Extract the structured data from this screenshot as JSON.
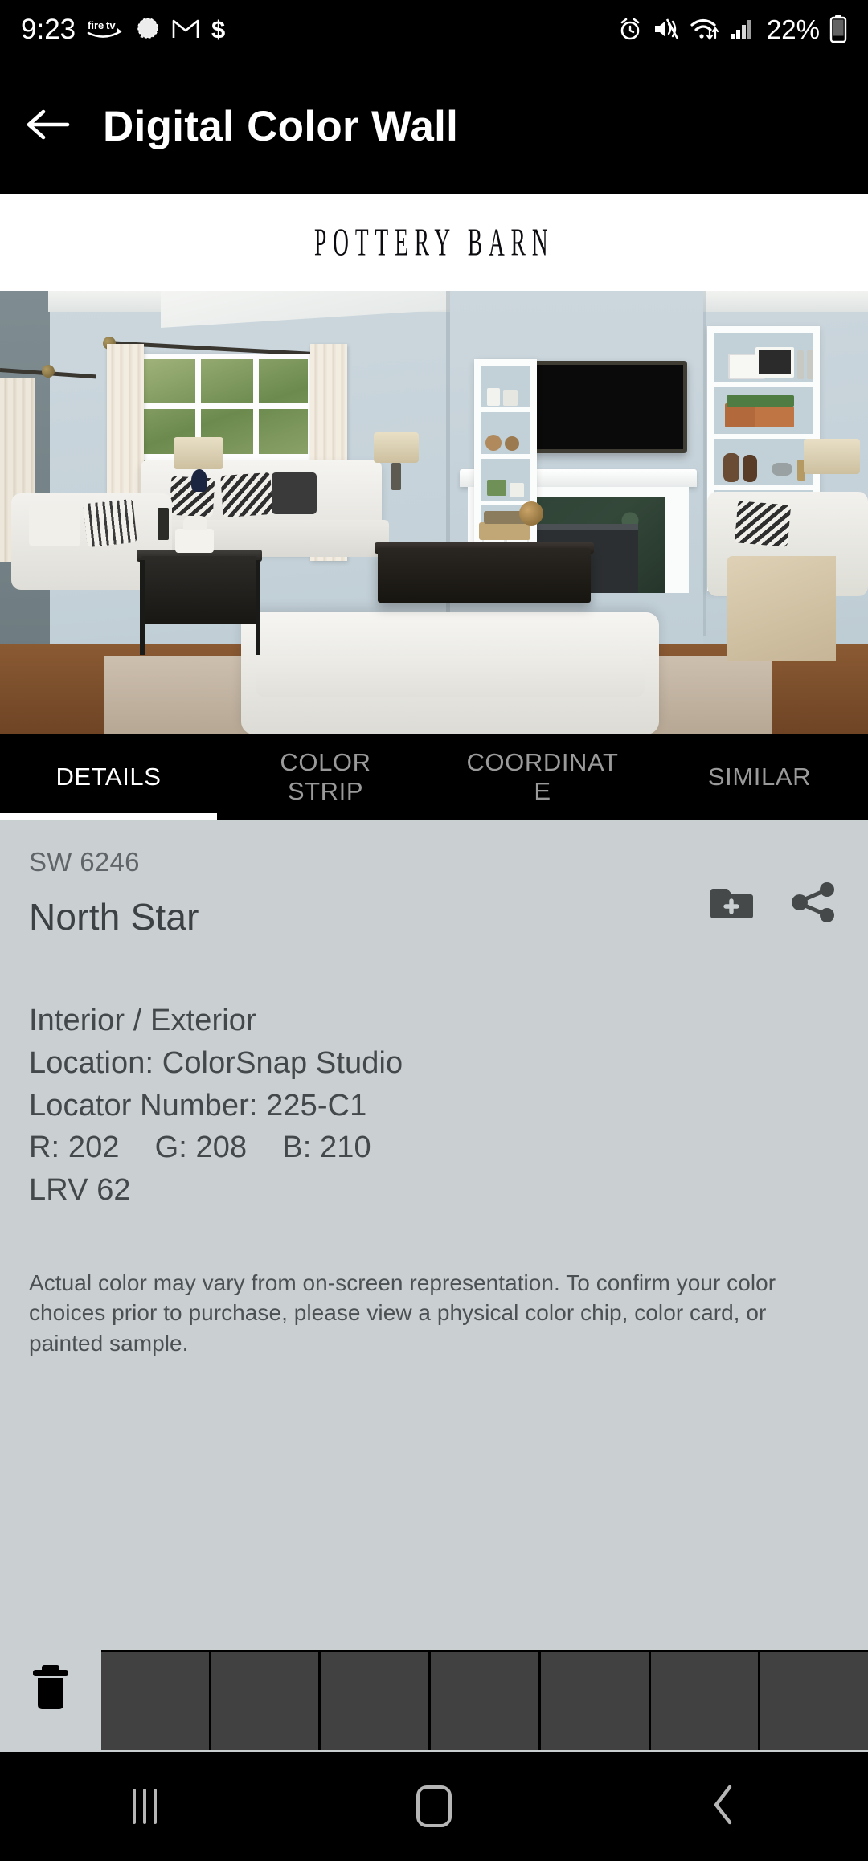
{
  "status_bar": {
    "time": "9:23",
    "battery_percent": "22%",
    "left_icons": [
      "firetv-icon",
      "signal-messenger-icon",
      "gmail-icon",
      "dollar-icon"
    ],
    "right_icons": [
      "alarm-icon",
      "mute-vibrate-icon",
      "wifi-icon",
      "cellular-signal-icon",
      "battery-icon"
    ]
  },
  "app_bar": {
    "back_icon": "back-arrow-icon",
    "title": "Digital Color Wall",
    "overflow_icon": "overflow-menu-icon"
  },
  "brand": {
    "logo_text": "POTTERY BARN"
  },
  "hero": {
    "scene_alt": "living room painted in North Star",
    "carousel": {
      "count": 5,
      "active_index": 0
    },
    "night_mode_icon": "moon-sparkles-icon"
  },
  "tabs": [
    {
      "label": "DETAILS",
      "active": true
    },
    {
      "label": "COLOR\nSTRIP",
      "active": false
    },
    {
      "label": "COORDINAT\nE",
      "active": false
    },
    {
      "label": "SIMILAR",
      "active": false
    }
  ],
  "color_detail": {
    "code": "SW 6246",
    "name": "North Star",
    "add_to_folder_icon": "folder-plus-icon",
    "share_icon": "share-icon",
    "usage": "Interior / Exterior",
    "location": "Location: ColorSnap Studio",
    "locator_number": "Locator Number: 225-C1",
    "r": "R: 202",
    "g": "G: 208",
    "b": "B: 210",
    "lrv": "LRV 62",
    "disclaimer": "Actual color may vary from on-screen representation. To confirm your color choices prior to purchase, please view a physical color chip, color card, or painted sample.",
    "swatch_hex": "#cad0d2"
  },
  "palette_strip": {
    "delete_icon": "trash-icon",
    "slot_count": 7,
    "slot_hex": "#414141"
  },
  "nav_bar": {
    "recents_icon": "recents-icon",
    "home_icon": "home-icon",
    "back_icon": "nav-back-icon"
  }
}
